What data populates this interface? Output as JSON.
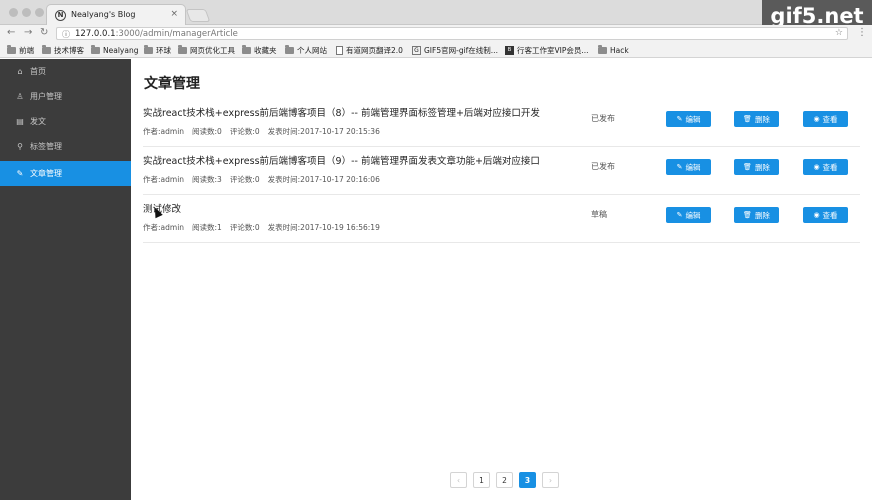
{
  "browser": {
    "tab_title": "Nealyang's Blog",
    "tab_favicon": "N",
    "close_glyph": "×",
    "url_host": "127.0.0.1",
    "url_path": ":3000/admin/managerArticle",
    "watermark": "gif5.net",
    "bookmarks": [
      {
        "label": "前端",
        "icon": "folder-icon"
      },
      {
        "label": "技术博客",
        "icon": "folder-icon"
      },
      {
        "label": "Nealyang",
        "icon": "folder-icon"
      },
      {
        "label": "环球",
        "icon": "folder-icon"
      },
      {
        "label": "网页优化工具",
        "icon": "folder-icon"
      },
      {
        "label": "收藏夹",
        "icon": "folder-icon"
      },
      {
        "label": "个人网站",
        "icon": "folder-icon"
      },
      {
        "label": "有道网页翻译2.0",
        "icon": "page-icon"
      },
      {
        "label": "GIF5官网-gif在线制...",
        "icon": "g-icon"
      },
      {
        "label": "行客工作室VIP会员...",
        "icon": "b-icon"
      },
      {
        "label": "Hack",
        "icon": "folder-icon"
      }
    ]
  },
  "sidebar": {
    "items": [
      {
        "label": "首页",
        "icon": "home-icon",
        "glyph": "⌂"
      },
      {
        "label": "用户管理",
        "icon": "user-icon",
        "glyph": "♙"
      },
      {
        "label": "发文",
        "icon": "file-icon",
        "glyph": "▤"
      },
      {
        "label": "标签管理",
        "icon": "tag-icon",
        "glyph": "⚲"
      },
      {
        "label": "文章管理",
        "icon": "edit-icon",
        "glyph": "✎",
        "active": true
      }
    ]
  },
  "main": {
    "title": "文章管理",
    "articles": [
      {
        "title": "实战react技术栈+express前后端博客项目（8）-- 前端管理界面标签管理+后端对应接口开发",
        "author": "作者:admin",
        "reads": "阅读数:0",
        "comments": "评论数:0",
        "time": "发表时间:2017-10-17 20:15:36",
        "status": "已发布"
      },
      {
        "title": "实战react技术栈+express前后端博客项目（9）-- 前端管理界面发表文章功能+后端对应接口",
        "author": "作者:admin",
        "reads": "阅读数:3",
        "comments": "评论数:0",
        "time": "发表时间:2017-10-17 20:16:06",
        "status": "已发布"
      },
      {
        "title": "测试修改",
        "author": "作者:admin",
        "reads": "阅读数:1",
        "comments": "评论数:0",
        "time": "发表时间:2017-10-19 16:56:19",
        "status": "草稿"
      }
    ],
    "buttons": {
      "edit": "编辑",
      "delete": "删除",
      "view": "查看"
    }
  },
  "pagination": {
    "prev": "‹",
    "pages": [
      "1",
      "2",
      "3"
    ],
    "current": "3",
    "next": "›"
  },
  "colors": {
    "accent": "#1890e3",
    "sidebar_bg": "#3c3c3c"
  }
}
